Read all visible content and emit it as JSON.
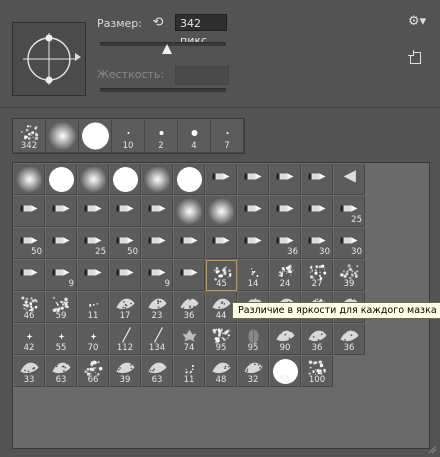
{
  "panel": {
    "size_label": "Размер:",
    "size_value": "342 пикс.",
    "size_fraction": 0.53,
    "hardness_label": "Жесткость:",
    "hardness_value": ""
  },
  "icons": {
    "reset": "reset-icon",
    "settings": "gear-icon",
    "new_preset": "new-preset-icon"
  },
  "recent_brushes": [
    {
      "label": "342",
      "kind": "splatter"
    },
    {
      "label": "",
      "kind": "soft"
    },
    {
      "label": "",
      "kind": "hard"
    },
    {
      "label": "10",
      "kind": "dot"
    },
    {
      "label": "2",
      "kind": "dot"
    },
    {
      "label": "4",
      "kind": "dot"
    },
    {
      "label": "7",
      "kind": "dot"
    }
  ],
  "brush_rows": [
    [
      {
        "label": "",
        "kind": "soft"
      },
      {
        "label": "",
        "kind": "hard"
      },
      {
        "label": "",
        "kind": "soft"
      },
      {
        "label": "",
        "kind": "hard"
      },
      {
        "label": "",
        "kind": "soft"
      },
      {
        "label": "",
        "kind": "hard"
      },
      {
        "label": "",
        "kind": "tip"
      },
      {
        "label": "",
        "kind": "tip"
      },
      {
        "label": "",
        "kind": "tip"
      },
      {
        "label": "",
        "kind": "tip"
      },
      {
        "label": "",
        "kind": "fan"
      }
    ],
    [
      {
        "label": "",
        "kind": "tip"
      },
      {
        "label": "",
        "kind": "tip"
      },
      {
        "label": "",
        "kind": "tip"
      },
      {
        "label": "",
        "kind": "tip"
      },
      {
        "label": "",
        "kind": "tip"
      },
      {
        "label": "",
        "kind": "soft"
      },
      {
        "label": "",
        "kind": "soft"
      },
      {
        "label": "",
        "kind": "tip"
      },
      {
        "label": "",
        "kind": "tip"
      },
      {
        "label": "",
        "kind": "tip"
      },
      {
        "label": "25",
        "kind": "tip"
      }
    ],
    [
      {
        "label": "50",
        "kind": "tip"
      },
      {
        "label": "",
        "kind": "tip"
      },
      {
        "label": "25",
        "kind": "tip"
      },
      {
        "label": "50",
        "kind": "tip"
      },
      {
        "label": "",
        "kind": "tip"
      },
      {
        "label": "",
        "kind": "tip"
      },
      {
        "label": "",
        "kind": "tip"
      },
      {
        "label": "",
        "kind": "tip"
      },
      {
        "label": "36",
        "kind": "tip"
      },
      {
        "label": "30",
        "kind": "tip"
      },
      {
        "label": "30",
        "kind": "tip"
      }
    ],
    [
      {
        "label": "",
        "kind": "tip"
      },
      {
        "label": "9",
        "kind": "tip"
      },
      {
        "label": "",
        "kind": "tip"
      },
      {
        "label": "",
        "kind": "tip"
      },
      {
        "label": "9",
        "kind": "tip"
      },
      {
        "label": "",
        "kind": "tip"
      },
      {
        "label": "45",
        "kind": "splatter"
      },
      {
        "label": "14",
        "kind": "speck"
      },
      {
        "label": "24",
        "kind": "texture"
      },
      {
        "label": "27",
        "kind": "texture"
      },
      {
        "label": "39",
        "kind": "texture"
      }
    ],
    [
      {
        "label": "46",
        "kind": "texture"
      },
      {
        "label": "59",
        "kind": "texture"
      },
      {
        "label": "11",
        "kind": "speck"
      },
      {
        "label": "17",
        "kind": "leaf"
      },
      {
        "label": "23",
        "kind": "leaf"
      },
      {
        "label": "36",
        "kind": "leaf"
      },
      {
        "label": "44",
        "kind": "leaf"
      },
      {
        "label": "60",
        "kind": "leaf"
      },
      {
        "label": "14",
        "kind": "leaf"
      },
      {
        "label": "26",
        "kind": "leaf"
      },
      {
        "label": "33",
        "kind": "leaf"
      }
    ],
    [
      {
        "label": "42",
        "kind": "star"
      },
      {
        "label": "55",
        "kind": "star"
      },
      {
        "label": "70",
        "kind": "star"
      },
      {
        "label": "112",
        "kind": "grass"
      },
      {
        "label": "134",
        "kind": "grass"
      },
      {
        "label": "74",
        "kind": "maple"
      },
      {
        "label": "95",
        "kind": "texture"
      },
      {
        "label": "95",
        "kind": "oak"
      },
      {
        "label": "90",
        "kind": "leaf"
      },
      {
        "label": "36",
        "kind": "leaf"
      },
      {
        "label": "36",
        "kind": "leaf"
      }
    ],
    [
      {
        "label": "33",
        "kind": "leaf"
      },
      {
        "label": "63",
        "kind": "leaf"
      },
      {
        "label": "66",
        "kind": "texture"
      },
      {
        "label": "39",
        "kind": "leaf"
      },
      {
        "label": "63",
        "kind": "leaf"
      },
      {
        "label": "11",
        "kind": "speck"
      },
      {
        "label": "48",
        "kind": "leaf"
      },
      {
        "label": "32",
        "kind": "leaf"
      },
      {
        "label": "55",
        "kind": "hard"
      },
      {
        "label": "100",
        "kind": "texture"
      }
    ]
  ],
  "selected": {
    "row": 3,
    "col": 6
  },
  "tooltip": "Различие в яркости для каждого мазка"
}
